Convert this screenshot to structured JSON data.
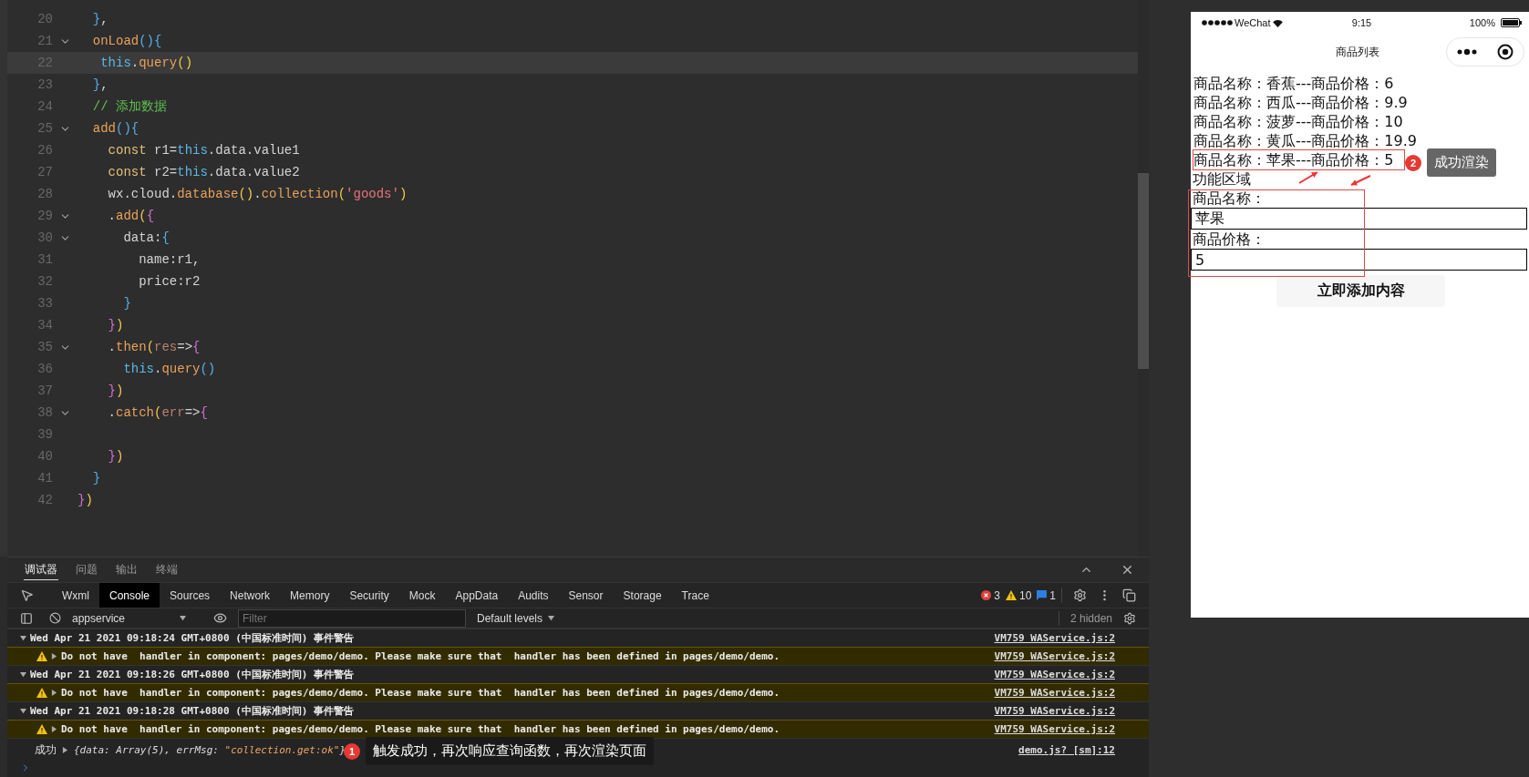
{
  "editor": {
    "lines": [
      {
        "number": "20",
        "foldable": false,
        "current": false,
        "tokens": [
          {
            "kind": "brace3",
            "text": "  }"
          },
          {
            "kind": "plain",
            "text": ","
          }
        ]
      },
      {
        "number": "21",
        "foldable": true,
        "current": false,
        "tokens": [
          {
            "kind": "func",
            "text": "  onLoad"
          },
          {
            "kind": "brace3",
            "text": "(){"
          }
        ]
      },
      {
        "number": "22",
        "foldable": false,
        "current": true,
        "tokens": [
          {
            "kind": "this",
            "text": "   this"
          },
          {
            "kind": "plain",
            "text": "."
          },
          {
            "kind": "func",
            "text": "query"
          },
          {
            "kind": "brace1",
            "text": "()"
          }
        ]
      },
      {
        "number": "23",
        "foldable": false,
        "current": false,
        "tokens": [
          {
            "kind": "brace3",
            "text": "  }"
          },
          {
            "kind": "plain",
            "text": ","
          }
        ]
      },
      {
        "number": "24",
        "foldable": false,
        "current": false,
        "tokens": [
          {
            "kind": "comment",
            "text": "  // 添加数据"
          }
        ]
      },
      {
        "number": "25",
        "foldable": true,
        "current": false,
        "tokens": [
          {
            "kind": "func",
            "text": "  add"
          },
          {
            "kind": "brace3",
            "text": "(){"
          }
        ]
      },
      {
        "number": "26",
        "foldable": false,
        "current": false,
        "tokens": [
          {
            "kind": "keyword",
            "text": "    const"
          },
          {
            "kind": "plain",
            "text": " r1="
          },
          {
            "kind": "this",
            "text": "this"
          },
          {
            "kind": "plain",
            "text": ".data.value1"
          }
        ]
      },
      {
        "number": "27",
        "foldable": false,
        "current": false,
        "tokens": [
          {
            "kind": "keyword",
            "text": "    const"
          },
          {
            "kind": "plain",
            "text": " r2="
          },
          {
            "kind": "this",
            "text": "this"
          },
          {
            "kind": "plain",
            "text": ".data.value2"
          }
        ]
      },
      {
        "number": "28",
        "foldable": false,
        "current": false,
        "tokens": [
          {
            "kind": "plain",
            "text": "    wx.cloud."
          },
          {
            "kind": "func",
            "text": "database"
          },
          {
            "kind": "brace1",
            "text": "()"
          },
          {
            "kind": "plain",
            "text": "."
          },
          {
            "kind": "func",
            "text": "collection"
          },
          {
            "kind": "brace1",
            "text": "("
          },
          {
            "kind": "string",
            "text": "'goods'"
          },
          {
            "kind": "brace1",
            "text": ")"
          }
        ]
      },
      {
        "number": "29",
        "foldable": true,
        "current": false,
        "tokens": [
          {
            "kind": "plain",
            "text": "    ."
          },
          {
            "kind": "func",
            "text": "add"
          },
          {
            "kind": "brace1",
            "text": "("
          },
          {
            "kind": "brace2",
            "text": "{"
          }
        ]
      },
      {
        "number": "30",
        "foldable": true,
        "current": false,
        "tokens": [
          {
            "kind": "plain",
            "text": "      data:"
          },
          {
            "kind": "brace3",
            "text": "{"
          }
        ]
      },
      {
        "number": "31",
        "foldable": false,
        "current": false,
        "tokens": [
          {
            "kind": "plain",
            "text": "        name:r1,"
          }
        ]
      },
      {
        "number": "32",
        "foldable": false,
        "current": false,
        "tokens": [
          {
            "kind": "plain",
            "text": "        price:r2"
          }
        ]
      },
      {
        "number": "33",
        "foldable": false,
        "current": false,
        "tokens": [
          {
            "kind": "brace3",
            "text": "      }"
          }
        ]
      },
      {
        "number": "34",
        "foldable": false,
        "current": false,
        "tokens": [
          {
            "kind": "brace2",
            "text": "    }"
          },
          {
            "kind": "brace1",
            "text": ")"
          }
        ]
      },
      {
        "number": "35",
        "foldable": true,
        "current": false,
        "tokens": [
          {
            "kind": "plain",
            "text": "    ."
          },
          {
            "kind": "func",
            "text": "then"
          },
          {
            "kind": "brace1",
            "text": "("
          },
          {
            "kind": "param",
            "text": "res"
          },
          {
            "kind": "plain",
            "text": "=>"
          },
          {
            "kind": "brace2",
            "text": "{"
          }
        ]
      },
      {
        "number": "36",
        "foldable": false,
        "current": false,
        "tokens": [
          {
            "kind": "this",
            "text": "      this"
          },
          {
            "kind": "plain",
            "text": "."
          },
          {
            "kind": "func",
            "text": "query"
          },
          {
            "kind": "brace3",
            "text": "()"
          }
        ]
      },
      {
        "number": "37",
        "foldable": false,
        "current": false,
        "tokens": [
          {
            "kind": "brace2",
            "text": "    }"
          },
          {
            "kind": "brace1",
            "text": ")"
          }
        ]
      },
      {
        "number": "38",
        "foldable": true,
        "current": false,
        "tokens": [
          {
            "kind": "plain",
            "text": "    ."
          },
          {
            "kind": "func",
            "text": "catch"
          },
          {
            "kind": "brace1",
            "text": "("
          },
          {
            "kind": "param",
            "text": "err"
          },
          {
            "kind": "plain",
            "text": "=>"
          },
          {
            "kind": "brace2",
            "text": "{"
          }
        ]
      },
      {
        "number": "39",
        "foldable": false,
        "current": false
      },
      {
        "number": "40",
        "foldable": false,
        "current": false,
        "tokens": [
          {
            "kind": "brace2",
            "text": "    }"
          },
          {
            "kind": "brace1",
            "text": ")"
          }
        ]
      },
      {
        "number": "41",
        "foldable": false,
        "current": false,
        "tokens": [
          {
            "kind": "brace3",
            "text": "  }"
          }
        ]
      },
      {
        "number": "42",
        "foldable": false,
        "current": false,
        "tokens": [
          {
            "kind": "brace2",
            "text": "}"
          },
          {
            "kind": "brace1",
            "text": ")"
          }
        ]
      }
    ]
  },
  "devtools": {
    "drawer_tabs": [
      {
        "label": "调试器",
        "selected": true
      },
      {
        "label": "问题",
        "selected": false
      },
      {
        "label": "输出",
        "selected": false
      },
      {
        "label": "终端",
        "selected": false
      }
    ],
    "tabs": [
      {
        "label": "Wxml",
        "selected": false
      },
      {
        "label": "Console",
        "selected": true
      },
      {
        "label": "Sources",
        "selected": false
      },
      {
        "label": "Network",
        "selected": false
      },
      {
        "label": "Memory",
        "selected": false
      },
      {
        "label": "Security",
        "selected": false
      },
      {
        "label": "Mock",
        "selected": false
      },
      {
        "label": "AppData",
        "selected": false
      },
      {
        "label": "Audits",
        "selected": false
      },
      {
        "label": "Sensor",
        "selected": false
      },
      {
        "label": "Storage",
        "selected": false
      },
      {
        "label": "Trace",
        "selected": false
      }
    ],
    "counts": {
      "errors": "3",
      "warnings": "10",
      "info": "1"
    },
    "context": "appservice",
    "filter": {
      "placeholder": "Filter"
    },
    "levels": "Default levels",
    "hidden": "2 hidden",
    "console": [
      {
        "kind": "group",
        "text": "Wed Apr 21 2021 09:18:24 GMT+0800 (中国标准时间) 事件警告",
        "source": "VM759 WAService.js:2"
      },
      {
        "kind": "warning",
        "text": "Do not have  handler in component: pages/demo/demo. Please make sure that  handler has been defined in pages/demo/demo.",
        "source": "VM759 WAService.js:2"
      },
      {
        "kind": "group",
        "text": "Wed Apr 21 2021 09:18:26 GMT+0800 (中国标准时间) 事件警告",
        "source": "VM759 WAService.js:2"
      },
      {
        "kind": "warning",
        "text": "Do not have  handler in component: pages/demo/demo. Please make sure that  handler has been defined in pages/demo/demo.",
        "source": "VM759 WAService.js:2"
      },
      {
        "kind": "group",
        "text": "Wed Apr 21 2021 09:18:28 GMT+0800 (中国标准时间) 事件警告",
        "source": "VM759 WAService.js:2"
      },
      {
        "kind": "warning",
        "text": "Do not have  handler in component: pages/demo/demo. Please make sure that  handler has been defined in pages/demo/demo.",
        "source": "VM759 WAService.js:2"
      }
    ],
    "result": {
      "label": "成功",
      "object_start": "{data: Array(5), errMsg: ",
      "object_string": "\"collection.get:ok\"",
      "object_end": "}",
      "source": "demo.js? [sm]:12",
      "note": {
        "number": "1",
        "text": "触发成功，再次响应查询函数，再次渲染页面"
      }
    }
  },
  "phone": {
    "status": {
      "carrier": "WeChat",
      "time": "9:15",
      "battery": "100%"
    },
    "title": "商品列表",
    "items": [
      {
        "text": "商品名称：香蕉---商品价格：6",
        "boxed": false
      },
      {
        "text": "商品名称：西瓜---商品价格：9.9",
        "boxed": false
      },
      {
        "text": "商品名称：菠萝---商品价格：10",
        "boxed": false
      },
      {
        "text": "商品名称：黄瓜---商品价格：19.9",
        "boxed": false
      },
      {
        "text": "商品名称：苹果---商品价格：5",
        "boxed": true
      }
    ],
    "note": {
      "number": "2",
      "text": "成功渲染"
    },
    "section": "功能区域",
    "form": {
      "boxed": true,
      "fields": [
        {
          "label": "商品名称：",
          "value": "苹果"
        },
        {
          "label": "商品价格：",
          "value": "5"
        }
      ]
    },
    "button": "立即添加内容"
  }
}
